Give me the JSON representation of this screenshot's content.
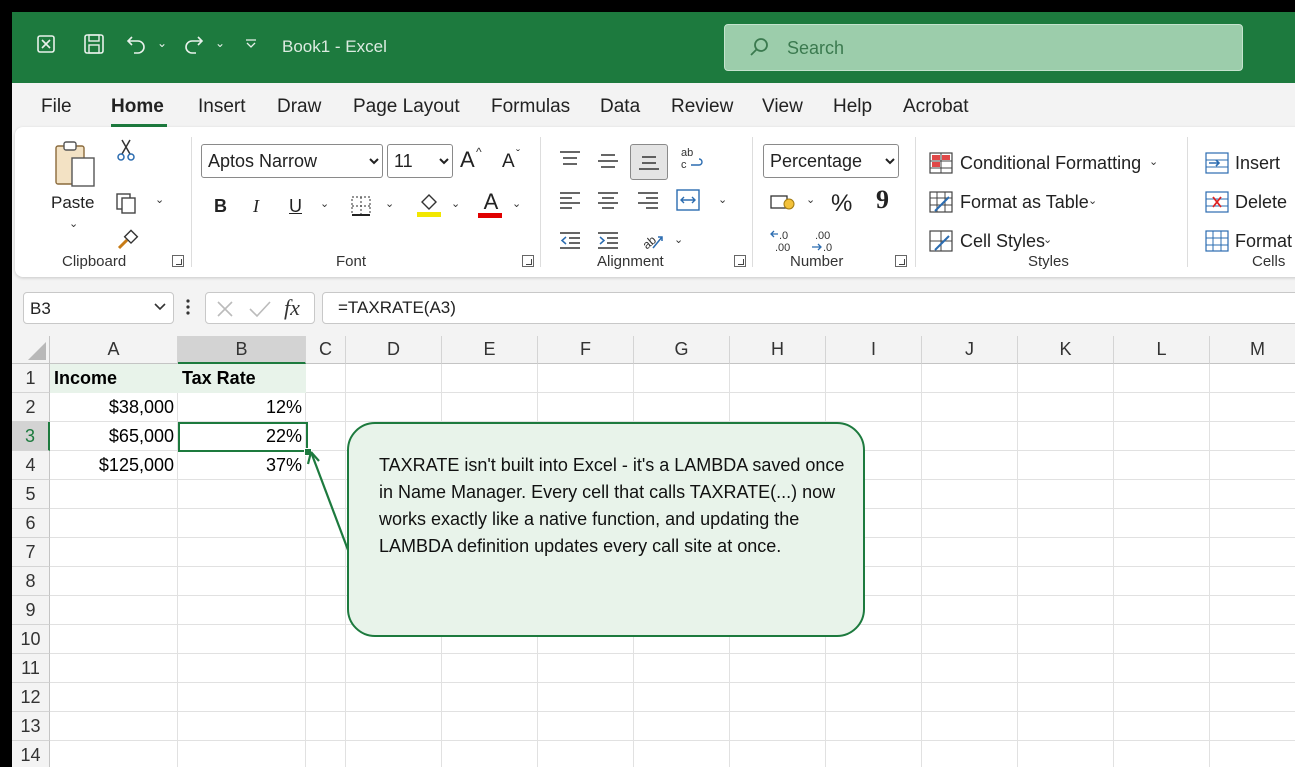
{
  "titlebar": {
    "doc_title": "Book1  -  Excel",
    "search_placeholder": "Search",
    "accent": "#1d7a3e"
  },
  "tabs": [
    {
      "label": "File"
    },
    {
      "label": "Home",
      "active": true
    },
    {
      "label": "Insert"
    },
    {
      "label": "Draw"
    },
    {
      "label": "Page Layout"
    },
    {
      "label": "Formulas"
    },
    {
      "label": "Data"
    },
    {
      "label": "Review"
    },
    {
      "label": "View"
    },
    {
      "label": "Help"
    },
    {
      "label": "Acrobat"
    }
  ],
  "ribbon": {
    "clipboard": {
      "paste_label": "Paste",
      "group_label": "Clipboard"
    },
    "font": {
      "font_name": "Aptos Narrow",
      "font_size": "11",
      "group_label": "Font",
      "bold": "B",
      "italic": "I",
      "underline": "U",
      "grow": "A",
      "shrink": "A",
      "font_color": "A"
    },
    "alignment": {
      "group_label": "Alignment"
    },
    "number": {
      "format": "Percentage",
      "group_label": "Number",
      "percent": "%",
      "comma": "9"
    },
    "styles": {
      "conditional": "Conditional Formatting",
      "format_table": "Format as Table",
      "cell_styles": "Cell Styles",
      "group_label": "Styles"
    },
    "cells": {
      "insert": "Insert",
      "delete": "Delete",
      "format": "Format",
      "group_label": "Cells"
    }
  },
  "formula_bar": {
    "name_box": "B3",
    "formula": "=TAXRATE(A3)",
    "fx": "fx"
  },
  "sheet": {
    "columns": [
      "A",
      "B",
      "C",
      "D",
      "E",
      "F",
      "G",
      "H",
      "I",
      "J",
      "K",
      "L",
      "M"
    ],
    "rows": [
      "1",
      "2",
      "3",
      "4",
      "5",
      "6",
      "7",
      "8",
      "9",
      "10",
      "11",
      "12",
      "13",
      "14"
    ],
    "cells": {
      "A1": "Income",
      "B1": "Tax Rate",
      "A2": "$38,000",
      "B2": "12%",
      "A3": "$65,000",
      "B3": "22%",
      "A4": "$125,000",
      "B4": "37%"
    },
    "selected_cell": "B3"
  },
  "callout": {
    "text": "TAXRATE isn't built into Excel - it's a LAMBDA saved once in Name Manager. Every cell that calls TAXRATE(...) now works exactly like a native function, and updating the LAMBDA definition updates every call site at once."
  }
}
